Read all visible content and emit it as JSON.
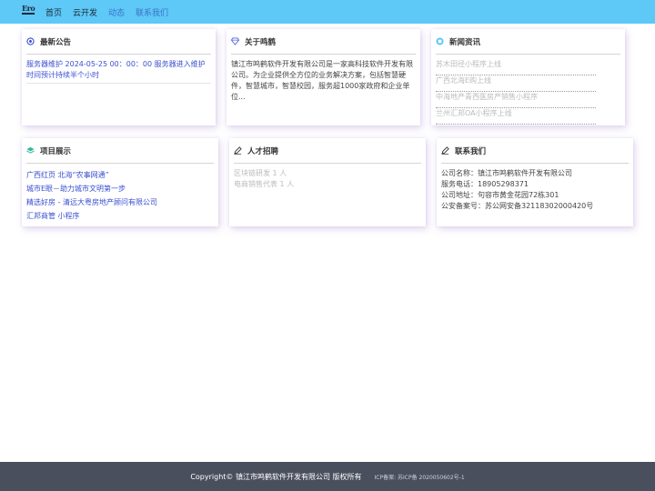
{
  "header": {
    "logo_text": "Ero",
    "nav": [
      {
        "label": "首页"
      },
      {
        "label": "云开发"
      },
      {
        "label": "动态"
      },
      {
        "label": "联系我们"
      }
    ]
  },
  "cards": {
    "announcement": {
      "title": "最新公告",
      "text": "服务器维护 2024-05-25 00：00：00 服务器进入维护时间预计持续半个小时"
    },
    "about": {
      "title": "关于鸣鹤",
      "text": "镇江市鸣鹤软件开发有限公司是一家高科技软件开发有限公司。为企业提供全方位的业务解决方案，包括智慧硬件，智慧城市，智慧校园，服务超1000家政府和企业单位..."
    },
    "news": {
      "title": "新闻资讯",
      "items": [
        "苏木田径小程序上线",
        "广西北海E购上线",
        "中海地产青西医房产销售小程序",
        "兰州汇邦OA小程序上线"
      ]
    },
    "projects": {
      "title": "项目展示",
      "items": [
        "广西红页 北海“农事网通”",
        "城市E眼－助力城市文明第一步",
        "精选好房 - 清远大粤房地产顾问有限公司",
        "汇邦商管 小程序"
      ]
    },
    "jobs": {
      "title": "人才招聘",
      "items": [
        "区块链研发 1 人",
        "电商销售代表 1 人"
      ]
    },
    "contact": {
      "title": "联系我们",
      "lines": [
        "公司名称：镇江市鸣鹤软件开发有限公司",
        "服务电话：18905298371",
        "公司地址：句容市黄金花园72栋301",
        "公安备案号：苏公网安备32118302000420号"
      ]
    }
  },
  "footer": {
    "copyright": "Copyright© 镇江市鸣鹤软件开发有限公司 版权所有",
    "icp": "ICP备案: 苏ICP备 2020050602号-1"
  },
  "colors": {
    "topbar": "#5ec8f7",
    "link_blue": "#3a4fd0",
    "footer": "#4a4f5e"
  }
}
